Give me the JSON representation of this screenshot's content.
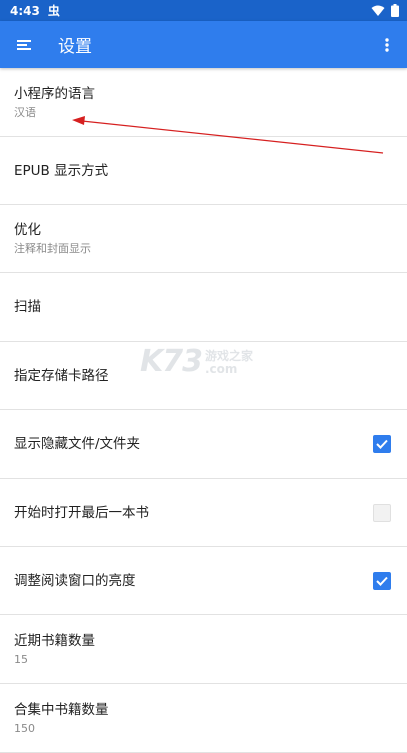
{
  "status_bar": {
    "time": "4:43",
    "notification_glyph": "虫",
    "icons": [
      "wifi-icon",
      "battery-icon"
    ]
  },
  "app_bar": {
    "title": "设置",
    "menu_icon": "menu-icon",
    "more_icon": "more-vert-icon"
  },
  "settings": [
    {
      "label": "小程序的语言",
      "sub": "汉语"
    },
    {
      "label": "EPUB 显示方式",
      "sub": ""
    },
    {
      "label": "优化",
      "sub": "注释和封面显示"
    },
    {
      "label": "扫描",
      "sub": ""
    },
    {
      "label": "指定存储卡路径",
      "sub": ""
    },
    {
      "label": "显示隐藏文件/文件夹",
      "sub": "",
      "checked": true
    },
    {
      "label": "开始时打开最后一本书",
      "sub": "",
      "checked": false
    },
    {
      "label": "调整阅读窗口的亮度",
      "sub": "",
      "checked": true
    },
    {
      "label": "近期书籍数量",
      "sub": "15"
    },
    {
      "label": "合集中书籍数量",
      "sub": "150"
    }
  ],
  "watermark": {
    "logo": "K73",
    "site": "游戏之家",
    "domain": ".com"
  },
  "colors": {
    "status_bar": "#1a63c9",
    "app_bar": "#2f7ded",
    "checkbox_on": "#2f7ded",
    "annotation_arrow": "#d62020"
  }
}
